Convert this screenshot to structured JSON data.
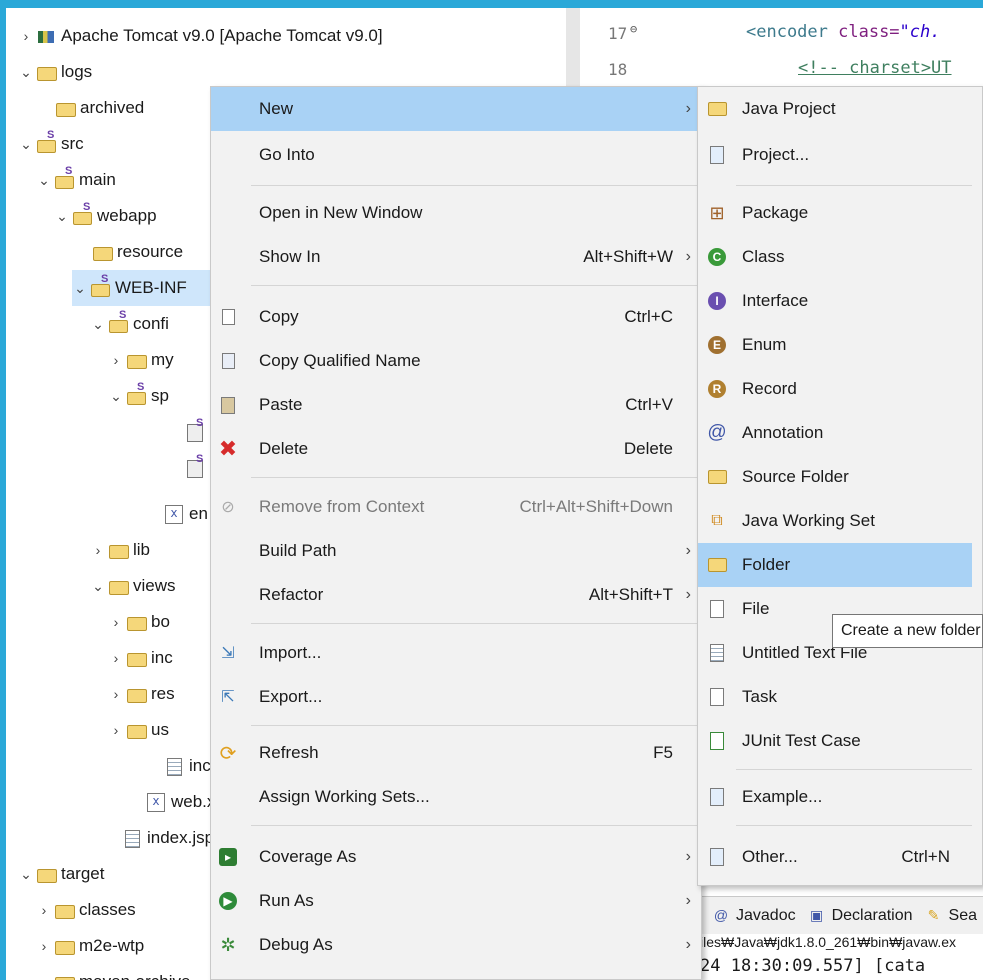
{
  "colors": {
    "accent": "#2aa8d8",
    "menu_highlight": "#a9d2f5",
    "tree_selection": "#cfe6fb"
  },
  "explorer": {
    "items": [
      {
        "label": "Apache Tomcat v9.0 [Apache Tomcat v9.0]",
        "icon": "server-icon"
      },
      {
        "label": "logs",
        "icon": "folder-icon"
      },
      {
        "label": "archived",
        "icon": "folder-icon"
      },
      {
        "label": "src",
        "icon": "source-folder-icon"
      },
      {
        "label": "main",
        "icon": "source-folder-icon"
      },
      {
        "label": "webapp",
        "icon": "source-folder-icon"
      },
      {
        "label": "resource",
        "icon": "folder-icon"
      },
      {
        "label": "WEB-INF",
        "icon": "source-folder-icon"
      },
      {
        "label": "confi",
        "icon": "source-folder-icon"
      },
      {
        "label": "my",
        "icon": "folder-icon"
      },
      {
        "label": "sp",
        "icon": "source-folder-icon"
      },
      {
        "label": "",
        "icon": "xml-file-icon"
      },
      {
        "label": "",
        "icon": "xml-file-icon"
      },
      {
        "label": "en",
        "icon": "xml-icon"
      },
      {
        "label": "lib",
        "icon": "folder-icon"
      },
      {
        "label": "views",
        "icon": "folder-icon"
      },
      {
        "label": "bo",
        "icon": "folder-icon"
      },
      {
        "label": "inc",
        "icon": "folder-icon"
      },
      {
        "label": "res",
        "icon": "folder-icon"
      },
      {
        "label": "us",
        "icon": "folder-icon"
      },
      {
        "label": "inc",
        "icon": "jsp-file-icon"
      },
      {
        "label": "web.x",
        "icon": "xml-icon"
      },
      {
        "label": "index.jsp",
        "icon": "jsp-file-icon"
      },
      {
        "label": "target",
        "icon": "folder-icon"
      },
      {
        "label": "classes",
        "icon": "folder-icon"
      },
      {
        "label": "m2e-wtp",
        "icon": "folder-icon"
      },
      {
        "label": "maven-archive",
        "icon": "folder-icon"
      }
    ]
  },
  "editor": {
    "line_numbers": [
      "17",
      "18"
    ],
    "line17": {
      "tag_open": "<encoder ",
      "attr": "class=",
      "str": "\"ch."
    },
    "line18": {
      "comment": "<!-- charset>UT"
    }
  },
  "context_menu": {
    "items": [
      {
        "label": "New",
        "accel": "",
        "submenu": true,
        "icon": ""
      },
      {
        "label": "Go Into",
        "accel": "",
        "submenu": false,
        "icon": ""
      },
      {
        "label": "Open in New Window",
        "accel": "",
        "submenu": false,
        "icon": ""
      },
      {
        "label": "Show In",
        "accel": "Alt+Shift+W",
        "submenu": true,
        "icon": ""
      },
      {
        "label": "Copy",
        "accel": "Ctrl+C",
        "submenu": false,
        "icon": "copy-icon"
      },
      {
        "label": "Copy Qualified Name",
        "accel": "",
        "submenu": false,
        "icon": "copy-qualified-name-icon"
      },
      {
        "label": "Paste",
        "accel": "Ctrl+V",
        "submenu": false,
        "icon": "paste-icon"
      },
      {
        "label": "Delete",
        "accel": "Delete",
        "submenu": false,
        "icon": "delete-icon"
      },
      {
        "label": "Remove from Context",
        "accel": "Ctrl+Alt+Shift+Down",
        "submenu": false,
        "icon": "remove-context-icon"
      },
      {
        "label": "Build Path",
        "accel": "",
        "submenu": true,
        "icon": ""
      },
      {
        "label": "Refactor",
        "accel": "Alt+Shift+T",
        "submenu": true,
        "icon": ""
      },
      {
        "label": "Import...",
        "accel": "",
        "submenu": false,
        "icon": "import-icon"
      },
      {
        "label": "Export...",
        "accel": "",
        "submenu": false,
        "icon": "export-icon"
      },
      {
        "label": "Refresh",
        "accel": "F5",
        "submenu": false,
        "icon": "refresh-icon"
      },
      {
        "label": "Assign Working Sets...",
        "accel": "",
        "submenu": false,
        "icon": ""
      },
      {
        "label": "Coverage As",
        "accel": "",
        "submenu": true,
        "icon": "coverage-icon"
      },
      {
        "label": "Run As",
        "accel": "",
        "submenu": true,
        "icon": "run-icon"
      },
      {
        "label": "Debug As",
        "accel": "",
        "submenu": true,
        "icon": "debug-icon"
      }
    ]
  },
  "new_submenu": {
    "items": [
      {
        "label": "Java Project",
        "accel": "",
        "icon": "java-project-icon"
      },
      {
        "label": "Project...",
        "accel": "",
        "icon": "project-icon"
      },
      {
        "label": "Package",
        "accel": "",
        "icon": "package-icon"
      },
      {
        "label": "Class",
        "accel": "",
        "icon": "class-icon"
      },
      {
        "label": "Interface",
        "accel": "",
        "icon": "interface-icon"
      },
      {
        "label": "Enum",
        "accel": "",
        "icon": "enum-icon"
      },
      {
        "label": "Record",
        "accel": "",
        "icon": "record-icon"
      },
      {
        "label": "Annotation",
        "accel": "",
        "icon": "annotation-icon"
      },
      {
        "label": "Source Folder",
        "accel": "",
        "icon": "source-folder-icon"
      },
      {
        "label": "Java Working Set",
        "accel": "",
        "icon": "working-set-icon"
      },
      {
        "label": "Folder",
        "accel": "",
        "icon": "folder-icon"
      },
      {
        "label": "File",
        "accel": "",
        "icon": "file-icon"
      },
      {
        "label": "Untitled Text File",
        "accel": "",
        "icon": "text-file-icon"
      },
      {
        "label": "Task",
        "accel": "",
        "icon": "task-icon"
      },
      {
        "label": "JUnit Test Case",
        "accel": "",
        "icon": "junit-icon"
      },
      {
        "label": "Example...",
        "accel": "",
        "icon": "example-icon"
      },
      {
        "label": "Other...",
        "accel": "Ctrl+N",
        "icon": "other-icon"
      }
    ]
  },
  "tooltip": {
    "text": "Create a new folder"
  },
  "bottom_panel": {
    "tabs": [
      {
        "label": "Javadoc",
        "icon": "at-icon"
      },
      {
        "label": "Declaration",
        "icon": "declaration-icon"
      },
      {
        "label": "Sea",
        "icon": "search-icon"
      }
    ],
    "console_path": "iles₩Java₩jdk1.8.0_261₩bin₩javaw.ex",
    "console_line": "24 18:30:09.557] [cata"
  }
}
